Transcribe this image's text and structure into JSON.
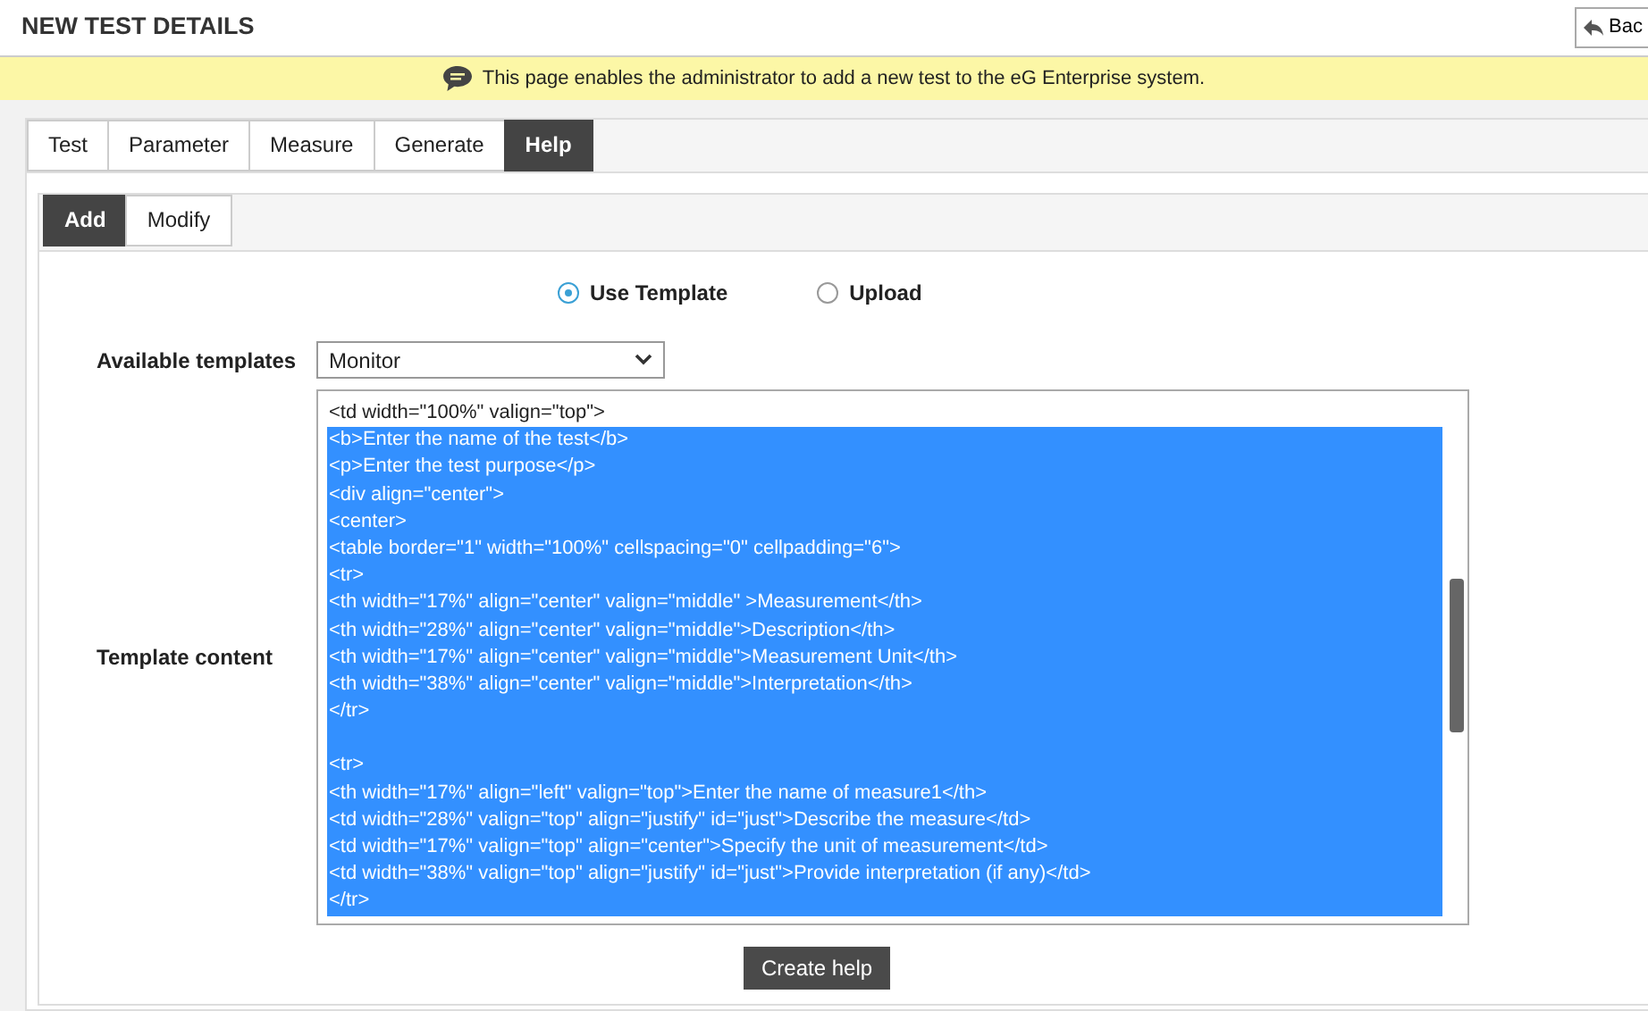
{
  "header": {
    "title": "NEW TEST DETAILS",
    "back_button": "Bac"
  },
  "info_bar": {
    "text": "This page enables the administrator to add a new test to the eG Enterprise system."
  },
  "tabs": [
    {
      "label": "Test",
      "selected": false
    },
    {
      "label": "Parameter",
      "selected": false
    },
    {
      "label": "Measure",
      "selected": false
    },
    {
      "label": "Generate",
      "selected": false
    },
    {
      "label": "Help",
      "selected": true
    }
  ],
  "sub_tabs": [
    {
      "label": "Add",
      "selected": true
    },
    {
      "label": "Modify",
      "selected": false
    }
  ],
  "source_options": [
    {
      "label": "Use Template",
      "selected": true
    },
    {
      "label": "Upload",
      "selected": false
    }
  ],
  "templates": {
    "label": "Available templates",
    "value": "Monitor"
  },
  "template_content": {
    "label": "Template content",
    "lines": [
      {
        "kind": "code",
        "text": "<td width=\"100%\" valign=\"top\">",
        "selected": false
      },
      {
        "kind": "code",
        "text": "<b>Enter the name of the test</b>",
        "selected": true
      },
      {
        "kind": "code",
        "text": "<p>Enter the test purpose</p>",
        "selected": true
      },
      {
        "kind": "code",
        "text": "<div align=\"center\">",
        "selected": true
      },
      {
        "kind": "code",
        "text": "<center>",
        "selected": true
      },
      {
        "kind": "code",
        "text": "<table border=\"1\" width=\"100%\" cellspacing=\"0\" cellpadding=\"6\">",
        "selected": true
      },
      {
        "kind": "code",
        "text": "<tr>",
        "selected": true
      },
      {
        "kind": "code",
        "text": "<th width=\"17%\" align=\"center\" valign=\"middle\" >Measurement</th>",
        "selected": true
      },
      {
        "kind": "code",
        "text": "<th width=\"28%\" align=\"center\" valign=\"middle\">Description</th>",
        "selected": true
      },
      {
        "kind": "code",
        "text": "<th width=\"17%\" align=\"center\" valign=\"middle\">Measurement Unit</th>",
        "selected": true
      },
      {
        "kind": "code",
        "text": "<th width=\"38%\" align=\"center\" valign=\"middle\">Interpretation</th>",
        "selected": true
      },
      {
        "kind": "code",
        "text": "</tr>",
        "selected": true
      },
      {
        "kind": "blank",
        "selected": true
      },
      {
        "kind": "code",
        "text": "<tr>",
        "selected": true
      },
      {
        "kind": "code",
        "text": "<th width=\"17%\" align=\"left\" valign=\"top\">Enter the name of measure1</th>",
        "selected": true
      },
      {
        "kind": "code",
        "text": "<td width=\"28%\" valign=\"top\" align=\"justify\" id=\"just\">Describe the measure</td>",
        "selected": true
      },
      {
        "kind": "code",
        "text": "<td width=\"17%\" valign=\"top\" align=\"center\">Specify the unit of measurement</td>",
        "selected": true
      },
      {
        "kind": "code",
        "text": "<td width=\"38%\" valign=\"top\" align=\"justify\" id=\"just\">Provide interpretation (if any)</td>",
        "selected": true
      },
      {
        "kind": "code",
        "text": "</tr>",
        "selected": true
      }
    ]
  },
  "create_button": "Create help"
}
